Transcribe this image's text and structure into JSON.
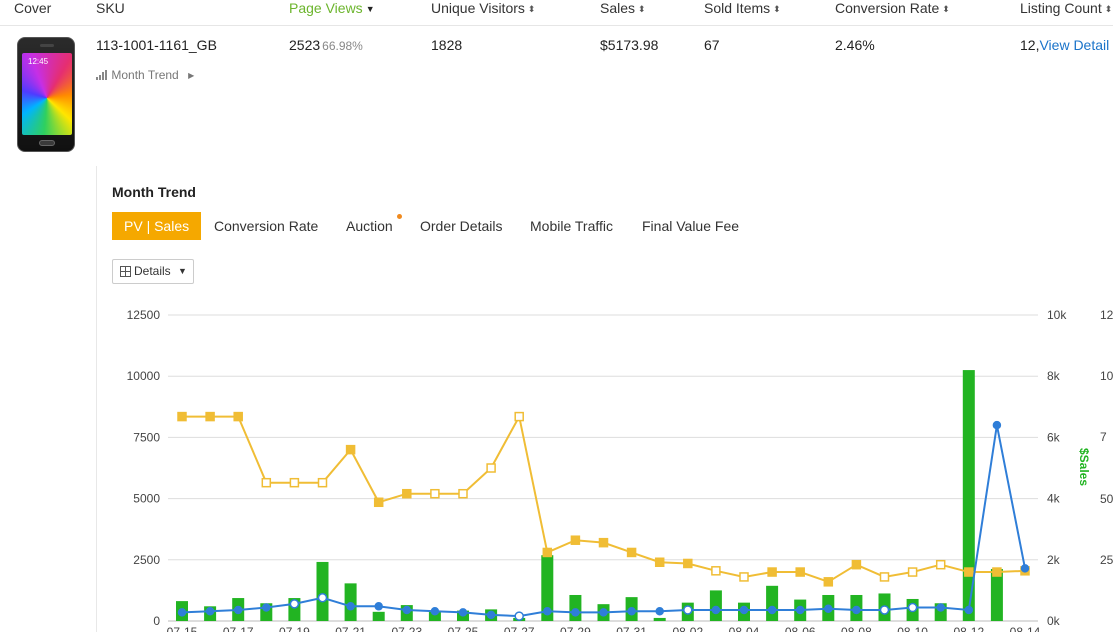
{
  "table": {
    "columns": [
      {
        "label": "Cover",
        "sort": false,
        "active": false
      },
      {
        "label": "SKU",
        "sort": false,
        "active": false
      },
      {
        "label": "Page Views",
        "sort": "desc",
        "active": true
      },
      {
        "label": "Unique Visitors",
        "sort": "both",
        "active": false
      },
      {
        "label": "Sales",
        "sort": "both",
        "active": false
      },
      {
        "label": "Sold Items",
        "sort": "both",
        "active": false
      },
      {
        "label": "Conversion Rate",
        "sort": "both",
        "active": false
      },
      {
        "label": "Listing Count",
        "sort": "both",
        "active": false
      }
    ],
    "row": {
      "cover_clock": "12:45",
      "sku": "113-1001-1161_GB",
      "page_views": "2523",
      "page_views_pct": "66.98%",
      "unique_visitors": "1828",
      "sales": "$5173.98",
      "sold_items": "67",
      "conversion_rate": "2.46%",
      "listing_count": "12,",
      "view_detail": "View Detail",
      "month_trend_link": "Month Trend"
    }
  },
  "trend": {
    "title": "Month Trend",
    "tabs": [
      {
        "label": "PV | Sales",
        "active": true,
        "dot": false
      },
      {
        "label": "Conversion Rate",
        "active": false,
        "dot": false
      },
      {
        "label": "Auction",
        "active": false,
        "dot": true
      },
      {
        "label": "Order Details",
        "active": false,
        "dot": false
      },
      {
        "label": "Mobile Traffic",
        "active": false,
        "dot": false
      },
      {
        "label": "Final Value Fee",
        "active": false,
        "dot": false
      }
    ],
    "details_button": "Details"
  },
  "chart_data": {
    "type": "bar",
    "x": [
      "07-15",
      "07-16",
      "07-17",
      "07-18",
      "07-19",
      "07-20",
      "07-21",
      "07-22",
      "07-23",
      "07-24",
      "07-25",
      "07-26",
      "07-27",
      "07-28",
      "07-29",
      "07-30",
      "07-31",
      "08-01",
      "08-02",
      "08-03",
      "08-04",
      "08-05",
      "08-06",
      "08-07",
      "08-08",
      "08-09",
      "08-10",
      "08-11",
      "08-12",
      "08-13",
      "08-14"
    ],
    "x_tick_labels": [
      "07-15",
      "07-17",
      "07-19",
      "07-21",
      "07-23",
      "07-25",
      "07-27",
      "07-29",
      "07-31",
      "08-02",
      "08-04",
      "08-06",
      "08-08",
      "08-10",
      "08-12",
      "08-14"
    ],
    "y_left": {
      "ticks": [
        "0",
        "2500",
        "5000",
        "7500",
        "10000",
        "12500"
      ],
      "min": 0,
      "max": 12500
    },
    "y_right": {
      "ticks": [
        "0k",
        "2k",
        "4k",
        "6k",
        "8k",
        "10k"
      ],
      "min": 0,
      "max": 10000,
      "label": "$Sales"
    },
    "y_right2_ticks": [
      "12",
      "10",
      "7",
      "50",
      "25"
    ],
    "series": [
      {
        "type": "bar",
        "axis": "right",
        "color": "#22b422",
        "values": [
          650,
          480,
          750,
          580,
          750,
          1930,
          1230,
          300,
          520,
          330,
          340,
          380,
          100,
          2150,
          850,
          550,
          780,
          100,
          600,
          1000,
          600,
          1150,
          700,
          850,
          850,
          900,
          720,
          580,
          8200,
          1700
        ]
      },
      {
        "type": "line",
        "axis": "left",
        "color": "#f0bd35",
        "values": [
          8350,
          8350,
          8350,
          5650,
          5650,
          5650,
          7000,
          4850,
          5200,
          5200,
          5200,
          6250,
          8350,
          2800,
          3300,
          3200,
          2800,
          2400,
          2350,
          2050,
          1800,
          2000,
          2000,
          1600,
          2300,
          1800,
          2000,
          2300,
          2000,
          2000,
          2050
        ]
      },
      {
        "type": "line",
        "axis": "left",
        "color": "#2f7ed8",
        "values": [
          350,
          400,
          450,
          550,
          700,
          950,
          600,
          600,
          450,
          400,
          350,
          250,
          200,
          400,
          350,
          350,
          400,
          400,
          450,
          450,
          450,
          450,
          450,
          500,
          450,
          450,
          550,
          550,
          450,
          8000,
          2150
        ]
      }
    ]
  }
}
